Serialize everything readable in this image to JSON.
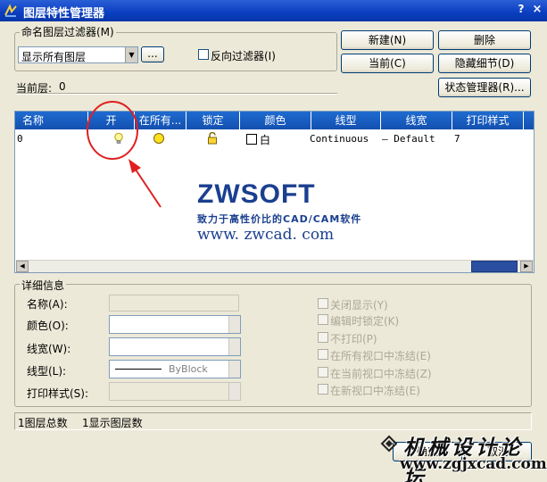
{
  "window": {
    "title": "图层特性管理器",
    "help": "?",
    "close": "×"
  },
  "filter": {
    "legend": "命名图层过滤器(M)",
    "selected": "显示所有图层",
    "browse": "...",
    "invert_label": "反向过滤器(I)"
  },
  "buttons": {
    "new": "新建(N)",
    "delete": "删除",
    "current": "当前(C)",
    "hide_details": "隐藏细节(D)",
    "state_manager": "状态管理器(R)...",
    "ok": "确定",
    "cancel": "取消"
  },
  "current_layer": {
    "label": "当前层:",
    "value": "0"
  },
  "columns": [
    "名称",
    "开",
    "在所有...",
    "锁定",
    "颜色",
    "线型",
    "线宽",
    "打印样式"
  ],
  "rows": [
    {
      "name": "0",
      "color": "白",
      "linetype": "Continuous",
      "lineweight": "— Default",
      "plotstyle": "7"
    }
  ],
  "watermark": {
    "brand": "ZWSOFT",
    "slogan": "致力于高性价比的CAD/CAM软件",
    "url": "www. zwcad. com"
  },
  "details": {
    "legend": "详细信息",
    "name_label": "名称(A):",
    "color_label": "颜色(O):",
    "lineweight_label": "线宽(W):",
    "linetype_label": "线型(L):",
    "plotstyle_label": "打印样式(S):",
    "linetype_value": "ByBlock",
    "options": [
      "关闭显示(Y)",
      "编辑时锁定(K)",
      "不打印(P)",
      "在所有视口中冻结(E)",
      "在当前视口中冻结(Z)",
      "在新视口中冻结(E)"
    ]
  },
  "status": {
    "total": "1图层总数",
    "shown": "1显示图层数"
  },
  "site_watermark": {
    "title": "机械设计论坛",
    "url": "www.zgjxcad.com"
  },
  "colors": {
    "titlebar": "#0a3dc0",
    "header": "#1350b0",
    "annotation": "#e02020"
  }
}
